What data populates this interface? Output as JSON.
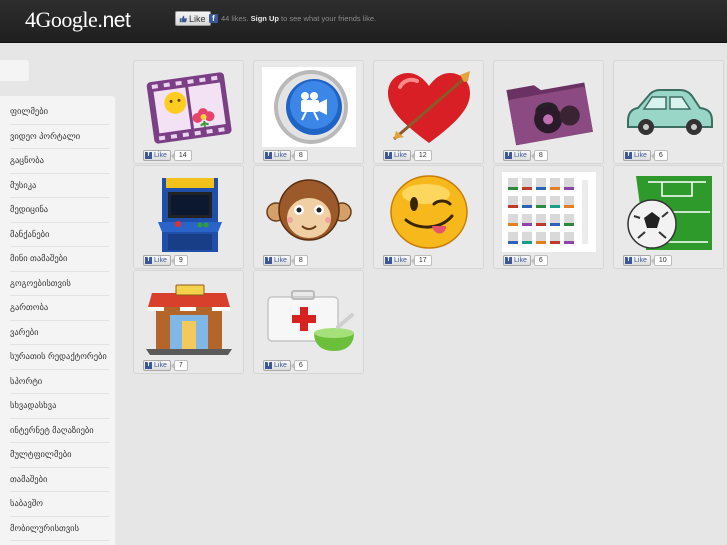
{
  "header": {
    "logo_main": "4Google",
    "logo_tld": ".net",
    "like_button": "Like",
    "likes_count": "44 likes.",
    "signup": "Sign Up",
    "signup_suffix": " to see what your friends like."
  },
  "sidebar": {
    "items": [
      "ფილმები",
      "ვიდეო პორტალი",
      "გაცნობა",
      "მუსიკა",
      "მედიცინა",
      "მანქანები",
      "მინი თამაშები",
      "გოგოებისთვის",
      "გართობა",
      "ვარები",
      "სურათის რედაქტორები",
      "სპორტი",
      "სხვადასხვა",
      "ინტერნეტ მაღაზიები",
      "მულტფილმები",
      "თამაშები",
      "საბავშო",
      "მობილურისთვის"
    ]
  },
  "cards": [
    {
      "icon": "film-strip-flower-icon",
      "like": "Like",
      "count": "14"
    },
    {
      "icon": "video-camera-button-icon",
      "like": "Like",
      "count": "8"
    },
    {
      "icon": "heart-arrow-icon",
      "like": "Like",
      "count": "12"
    },
    {
      "icon": "music-folder-icon",
      "like": "Like",
      "count": "8"
    },
    {
      "icon": "car-icon",
      "like": "Like",
      "count": "6"
    },
    {
      "icon": "arcade-machine-icon",
      "like": "Like",
      "count": "9"
    },
    {
      "icon": "monkey-face-icon",
      "like": "Like",
      "count": "8"
    },
    {
      "icon": "winking-smiley-icon",
      "like": "Like",
      "count": "17"
    },
    {
      "icon": "file-types-sheet-icon",
      "like": "Like",
      "count": "6"
    },
    {
      "icon": "soccer-ball-field-icon",
      "like": "Like",
      "count": "10"
    },
    {
      "icon": "shop-icon",
      "like": "Like",
      "count": "7"
    },
    {
      "icon": "first-aid-kit-icon",
      "like": "Like",
      "count": "6"
    }
  ],
  "colors": {
    "topbar": "#262626",
    "facebook": "#3b5998",
    "background": "#e6e6e6"
  }
}
